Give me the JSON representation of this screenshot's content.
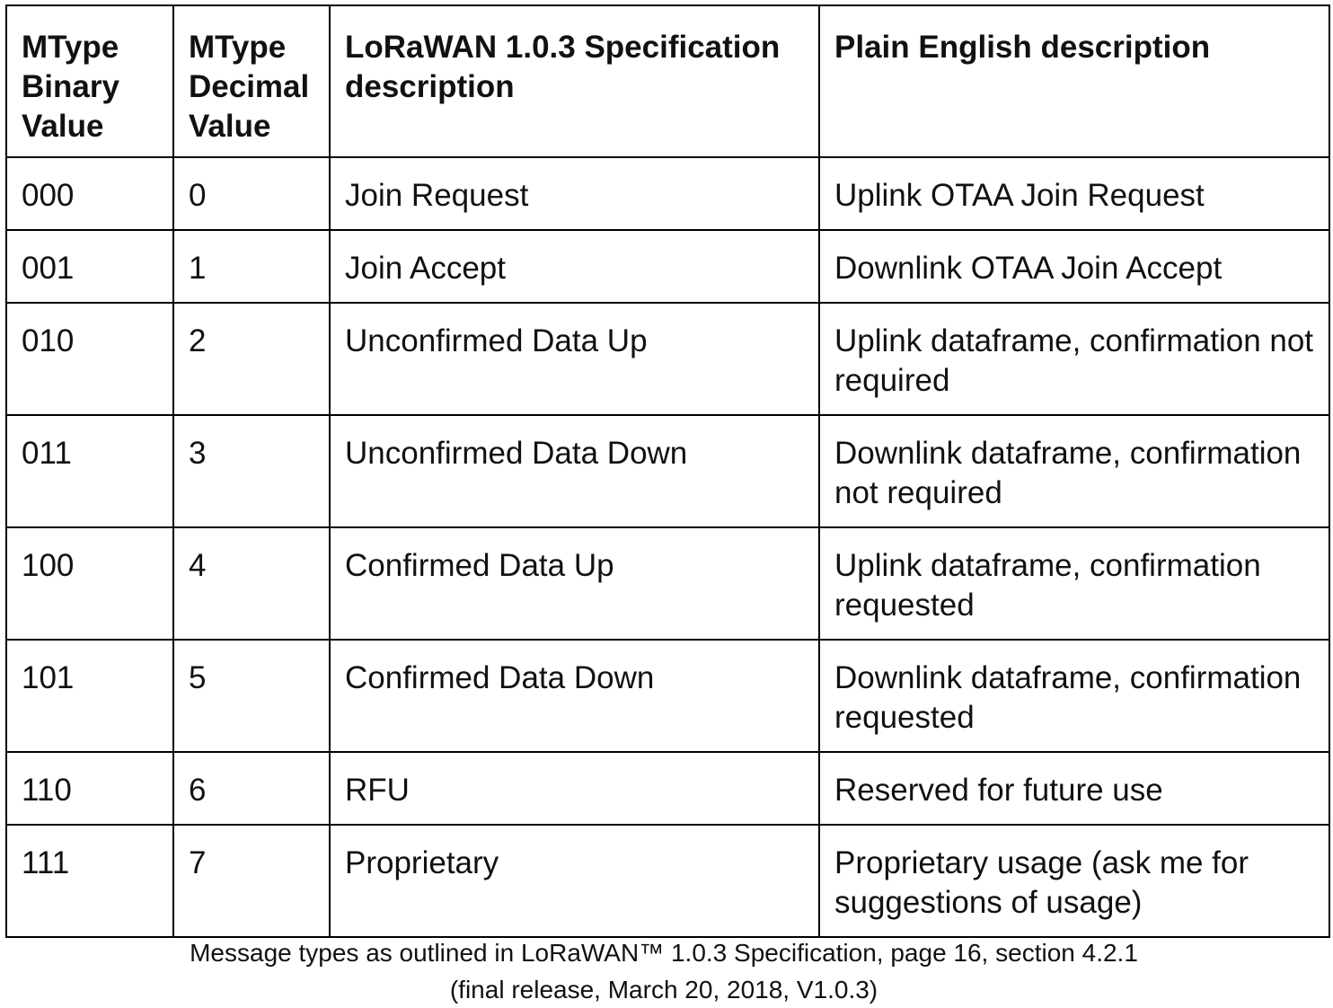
{
  "table": {
    "headers": [
      "MType Binary Value",
      "MType Decimal Value",
      "LoRaWAN 1.0.3 Specification description",
      "Plain English description"
    ],
    "rows": [
      [
        "000",
        "0",
        "Join Request",
        "Uplink OTAA Join Request"
      ],
      [
        "001",
        "1",
        "Join Accept",
        "Downlink OTAA Join Accept"
      ],
      [
        "010",
        "2",
        "Unconfirmed Data Up",
        "Uplink dataframe, confirmation not required"
      ],
      [
        "011",
        "3",
        "Unconfirmed Data Down",
        "Downlink dataframe, confirmation not required"
      ],
      [
        "100",
        "4",
        "Confirmed Data Up",
        "Uplink dataframe, confirmation requested"
      ],
      [
        "101",
        "5",
        "Confirmed Data Down",
        "Downlink dataframe, confirmation requested"
      ],
      [
        "110",
        "6",
        "RFU",
        "Reserved for future use"
      ],
      [
        "111",
        "7",
        "Proprietary",
        "Proprietary usage (ask me for suggestions of usage)"
      ]
    ]
  },
  "caption": {
    "line1": "Message types as outlined in LoRaWAN™ 1.0.3 Specification, page 16, section 4.2.1",
    "line2": "(final release, March 20, 2018, V1.0.3)"
  }
}
